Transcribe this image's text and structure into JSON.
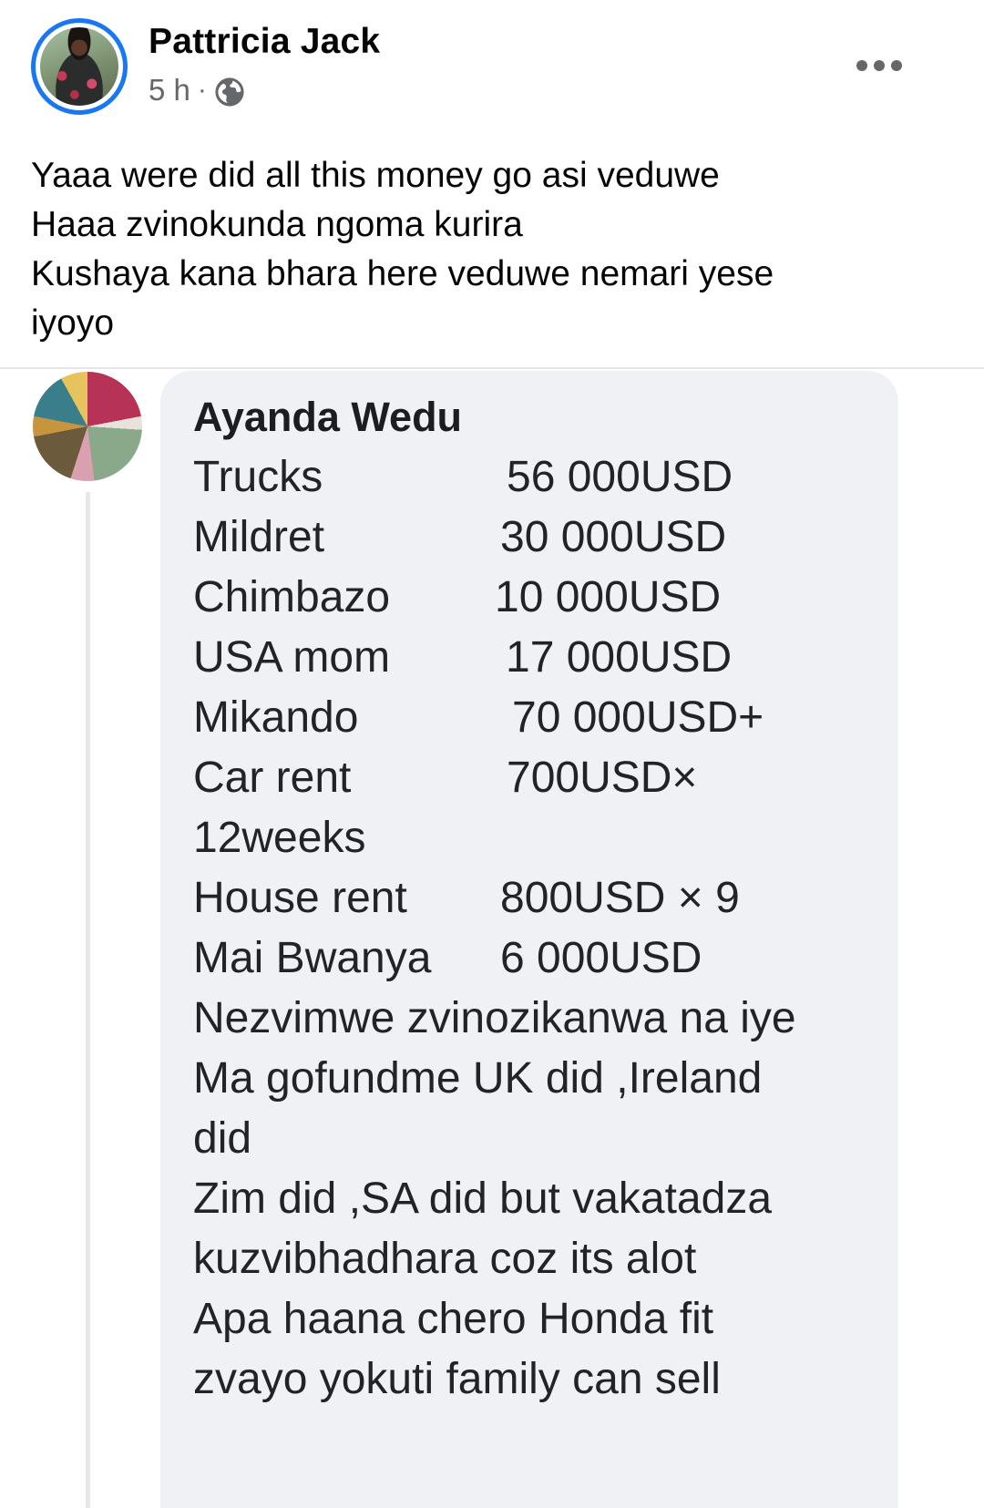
{
  "post": {
    "author": "Pattricia Jack",
    "time": "5 h",
    "separator": "·",
    "audience_icon": "globe-icon",
    "more_icon": "more-options-icon",
    "text_lines": [
      "Yaaa were did all this money go asi veduwe",
      "Haaa  zvinokunda ngoma kurira",
      "Kushaya kana bhara here veduwe nemari yese",
      "iyoyo"
    ]
  },
  "comment": {
    "author": "Ayanda Wedu",
    "rows": [
      {
        "label": "Trucks",
        "value": "56 000USD"
      },
      {
        "label": "Mildret",
        "value": "30 000USD"
      },
      {
        "label": "Chimbazo",
        "value": "10 000USD"
      },
      {
        "label": "USA mom",
        "value": "17 000USD"
      },
      {
        "label": "Mikando",
        "value": "70 000USD+"
      },
      {
        "label": "Car rent",
        "value": "700USD×"
      },
      {
        "label": "12weeks",
        "value": ""
      },
      {
        "label": "House rent",
        "value": "800USD × 9"
      },
      {
        "label": "Mai Bwanya",
        "value": "6 000USD"
      }
    ],
    "body_lines": [
      "Nezvimwe zvinozikanwa na iye",
      "Ma gofundme UK did ,Ireland",
      "did",
      "Zim did ,SA did but vakatadza",
      "kuzvibhadhara coz its alot",
      "Apa haana chero Honda fit",
      "zvayo yokuti family can sell"
    ]
  },
  "colors": {
    "accent": "#1877f2",
    "meta_grey": "#65676b",
    "bubble_bg": "#f0f1f4"
  }
}
